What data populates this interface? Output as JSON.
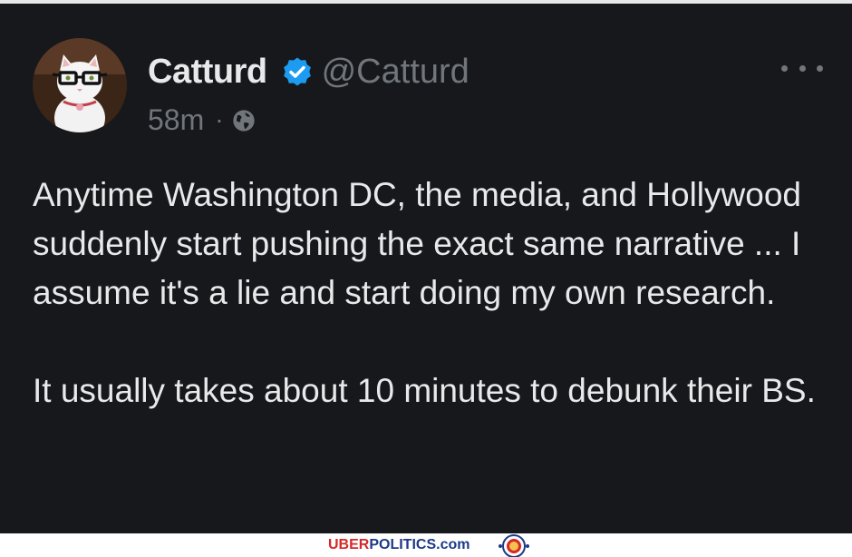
{
  "tweet": {
    "author": {
      "display_name": "Catturd",
      "handle": "@Catturd",
      "verified": true,
      "avatar_icon": "cat-with-glasses-avatar"
    },
    "timestamp": "58m",
    "separator": "·",
    "audience_icon": "globe-icon",
    "more_icon": "more-options-icon",
    "paragraphs": [
      "Anytime Washington DC, the media, and Hollywood suddenly start pushing the exact same narrative ... I assume it's a lie and start doing my own research.",
      "It usually takes about 10 minutes to debunk their BS."
    ]
  },
  "watermark": {
    "brand_part1": "UBER",
    "brand_part2": "POLITICS",
    "brand_part3": ".com"
  },
  "colors": {
    "background": "#16181c",
    "text_primary": "#e7e9ea",
    "text_secondary": "#71767b",
    "verified_blue": "#1d9bf0"
  }
}
